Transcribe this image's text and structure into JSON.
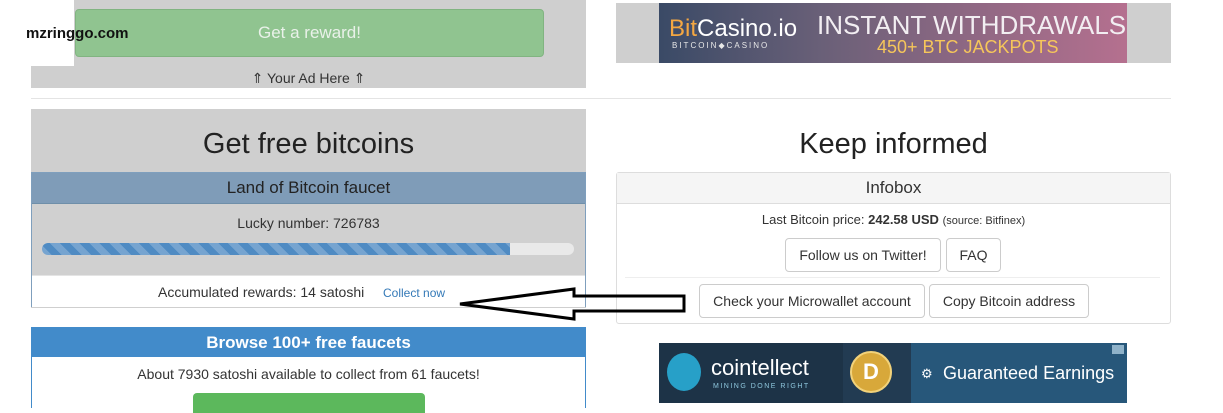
{
  "watermark": "mzringgo.com",
  "left": {
    "reward_button": "Get a reward!",
    "your_ad": "⇑ Your Ad Here ⇑",
    "title": "Get free bitcoins",
    "faucet": {
      "title": "Land of Bitcoin faucet",
      "lucky_number": "Lucky number: 726783",
      "progress_fraction": 0.88,
      "accumulated": "Accumulated rewards: 14 satoshi",
      "collect_link": "Collect now"
    },
    "browse": {
      "title": "Browse 100+ free faucets",
      "about": "About 7930 satoshi available to collect from 61 faucets!"
    }
  },
  "right": {
    "banner_top": {
      "logo_prefix": "Bit",
      "logo_rest": "Casino.io",
      "logo_sub": "BITCOIN◆CASINO",
      "headline": "INSTANT WITHDRAWALS",
      "subline": "450+ BTC JACKPOTS"
    },
    "title": "Keep informed",
    "infobox": {
      "title": "Infobox",
      "price_label": "Last Bitcoin price:",
      "price_value": "242.58 USD",
      "price_source": "(source: Bitfinex)",
      "twitter_button": "Follow us on Twitter!",
      "faq_button": "FAQ",
      "microwallet_button": "Check your Microwallet account",
      "copy_button": "Copy Bitcoin address"
    },
    "banner_bottom": {
      "brand": "cointellect",
      "tagline": "MINING DONE RIGHT",
      "doge_letter": "D",
      "guaranteed": "Guaranteed Earnings"
    }
  },
  "icons": {
    "arrow": "left-arrow-annotation",
    "brain": "brain-logo-icon",
    "doge": "dogecoin-icon"
  },
  "colors": {
    "primary": "#428bca",
    "success": "#5cb85c",
    "faucet_header": "#7f9cb8",
    "gray_block": "#cfcfcf"
  }
}
